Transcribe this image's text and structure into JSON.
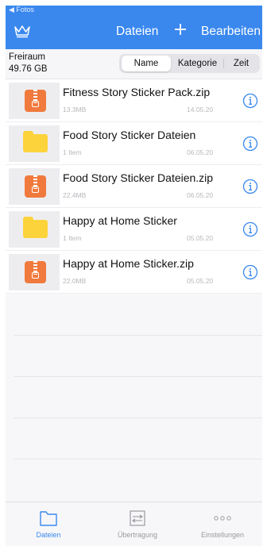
{
  "statusbar": {
    "back_label": "◀ Fotos"
  },
  "header": {
    "title": "Dateien",
    "add_icon": "plus-icon",
    "edit_label": "Bearbeiten",
    "premium_icon": "crown-icon",
    "color": "#3a88ee"
  },
  "storage": {
    "label": "Freiraum",
    "value": "49.76 GB"
  },
  "sort": {
    "options": [
      "Name",
      "Kategorie",
      "Zeit"
    ],
    "selected": "Name"
  },
  "files": [
    {
      "name": "Fitness Story Sticker Pack.zip",
      "meta": "13.3MB",
      "date": "14.05.20",
      "type": "zip"
    },
    {
      "name": "Food Story Sticker Dateien",
      "meta": "1 Item",
      "date": "06.05.20",
      "type": "folder"
    },
    {
      "name": "Food Story Sticker Dateien.zip",
      "meta": "22.4MB",
      "date": "06.05.20",
      "type": "zip"
    },
    {
      "name": "Happy at Home Sticker",
      "meta": "1 Item",
      "date": "05.05.20",
      "type": "folder"
    },
    {
      "name": "Happy at Home Sticker.zip",
      "meta": "22.0MB",
      "date": "05.05.20",
      "type": "zip"
    }
  ],
  "tabs": [
    {
      "label": "Dateien",
      "icon": "folder-icon",
      "active": true
    },
    {
      "label": "Übertragung",
      "icon": "transfer-icon",
      "active": false
    },
    {
      "label": "Einstellungen",
      "icon": "more-icon",
      "active": false
    }
  ]
}
